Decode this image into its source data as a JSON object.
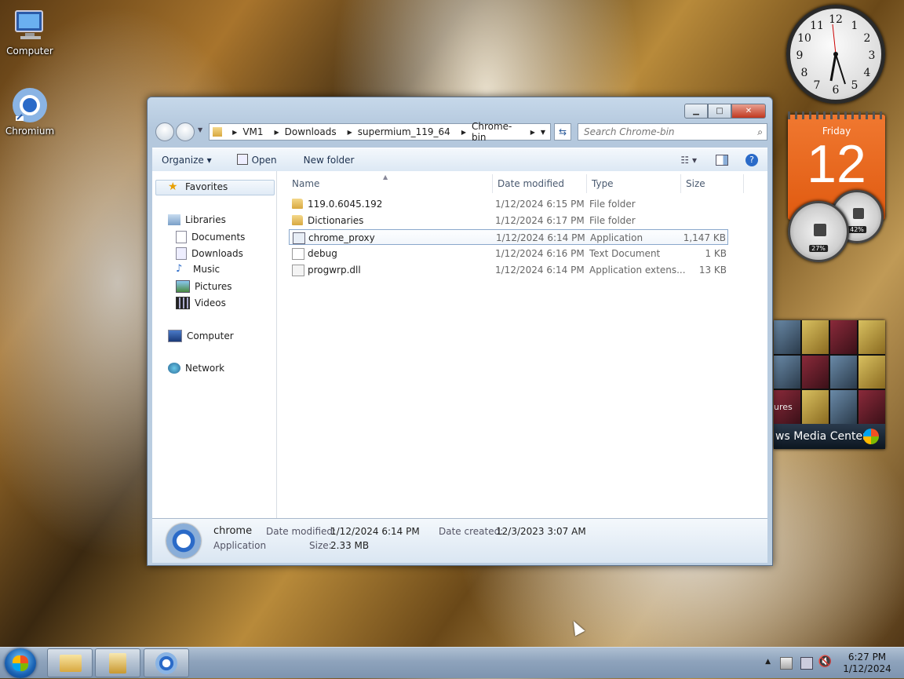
{
  "desktop": {
    "icons": [
      {
        "label": "Computer"
      },
      {
        "label": "Chromium"
      }
    ]
  },
  "gadgets": {
    "clock_numbers": [
      "12",
      "1",
      "2",
      "3",
      "4",
      "5",
      "6",
      "7",
      "8",
      "9",
      "10",
      "11"
    ],
    "calendar": {
      "day": "Friday",
      "date": "12"
    },
    "gauges": {
      "cpu": "27%",
      "memory": "42%"
    },
    "media_center": {
      "pictures_label": "ures",
      "bar_label": "ws Media Center"
    }
  },
  "window": {
    "breadcrumb": [
      "VM1",
      "Downloads",
      "supermium_119_64",
      "Chrome-bin"
    ],
    "search_placeholder": "Search Chrome-bin",
    "toolbar": {
      "organize": "Organize ▾",
      "open": "Open",
      "new_folder": "New folder"
    },
    "nav": {
      "favorites": "Favorites",
      "libraries": "Libraries",
      "documents": "Documents",
      "downloads": "Downloads",
      "music": "Music",
      "pictures": "Pictures",
      "videos": "Videos",
      "computer": "Computer",
      "network": "Network"
    },
    "columns": {
      "name": "Name",
      "date": "Date modified",
      "type": "Type",
      "size": "Size"
    },
    "files": [
      {
        "name": "119.0.6045.192",
        "date": "1/12/2024 6:15 PM",
        "type": "File folder",
        "size": ""
      },
      {
        "name": "Dictionaries",
        "date": "1/12/2024 6:17 PM",
        "type": "File folder",
        "size": ""
      },
      {
        "name": "chrome_proxy",
        "date": "1/12/2024 6:14 PM",
        "type": "Application",
        "size": "1,147 KB"
      },
      {
        "name": "debug",
        "date": "1/12/2024 6:16 PM",
        "type": "Text Document",
        "size": "1 KB"
      },
      {
        "name": "progwrp.dll",
        "date": "1/12/2024 6:14 PM",
        "type": "Application extens...",
        "size": "13 KB"
      }
    ],
    "details": {
      "name": "chrome",
      "kind": "Application",
      "modified_label": "Date modified:",
      "modified_value": "1/12/2024 6:14 PM",
      "created_label": "Date created:",
      "created_value": "12/3/2023 3:07 AM",
      "size_label": "Size:",
      "size_value": "2.33 MB"
    }
  },
  "taskbar": {
    "time": "6:27 PM",
    "date": "1/12/2024"
  },
  "colors": {
    "accent": "#2a6ac8",
    "close": "#c03820"
  }
}
